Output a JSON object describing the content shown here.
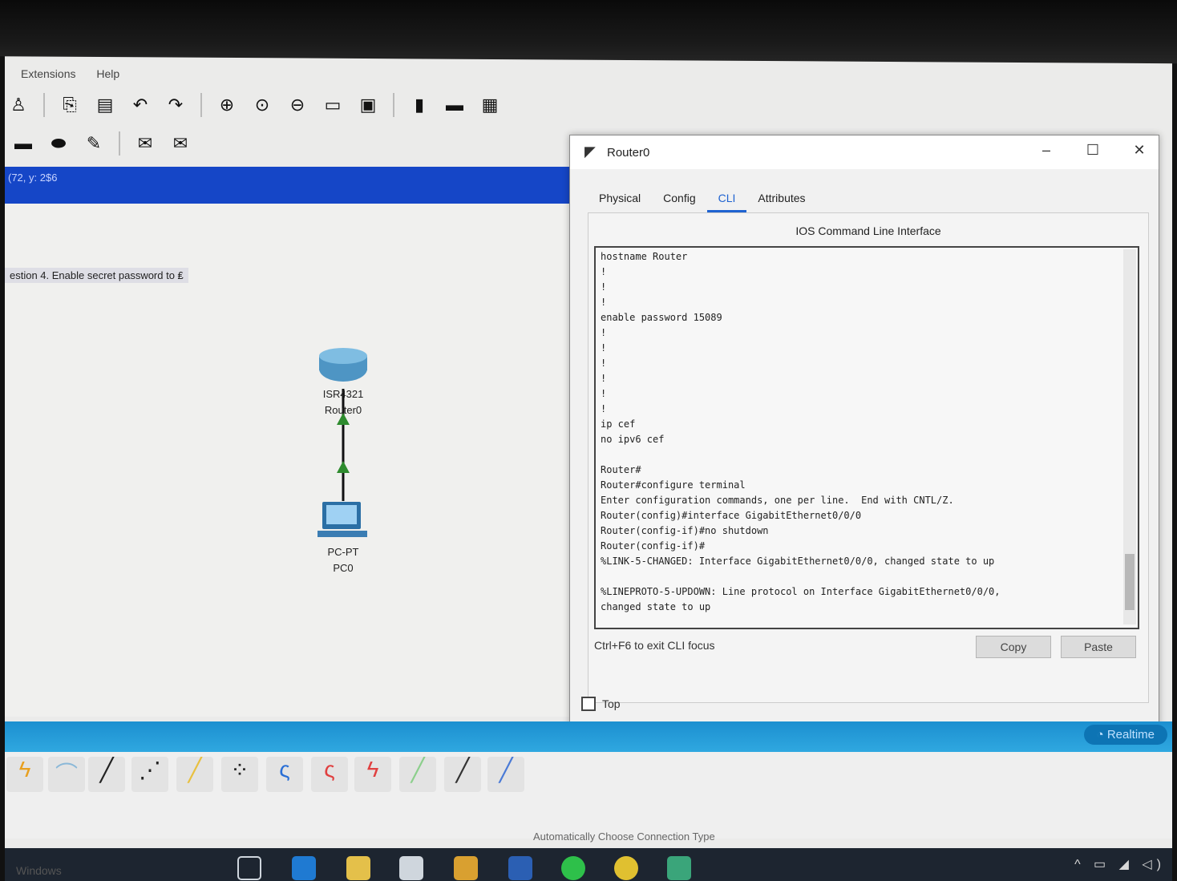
{
  "menu": {
    "extensions": "Extensions",
    "help": "Help"
  },
  "toolbar": {
    "row1": [
      "activity-wizard-icon",
      "copy-icon",
      "paste-icon",
      "undo-icon",
      "redo-icon",
      "zoom-in-icon",
      "zoom-reset-icon",
      "zoom-out-icon",
      "rectangle-icon",
      "palette-icon",
      "device-icon",
      "folder-icon",
      "image-icon"
    ],
    "row2": [
      "rect-draw-icon",
      "ellipse-draw-icon",
      "freeform-draw-icon",
      "mail-icon",
      "open-mail-icon"
    ]
  },
  "status": {
    "coords": "(72, y: 2$6"
  },
  "canvas": {
    "note": "estion 4. Enable secret password to ₤",
    "router": {
      "model": "ISR4321",
      "name": "Router0"
    },
    "pc": {
      "model": "PC-PT",
      "name": "PC0"
    }
  },
  "window": {
    "title": "Router0",
    "tabs": [
      "Physical",
      "Config",
      "CLI",
      "Attributes"
    ],
    "active_tab": "CLI",
    "heading": "IOS Command Line Interface",
    "console": "hostname Router\n!\n!\n!\nenable password 15089\n!\n!\n!\n!\n!\n!\nip cef\nno ipv6 cef\n\nRouter#\nRouter#configure terminal\nEnter configuration commands, one per line.  End with CNTL/Z.\nRouter(config)#interface GigabitEthernet0/0/0\nRouter(config-if)#no shutdown\nRouter(config-if)#\n%LINK-5-CHANGED: Interface GigabitEthernet0/0/0, changed state to up\n\n%LINEPROTO-5-UPDOWN: Line protocol on Interface GigabitEthernet0/0/0,\nchanged state to up",
    "hint": "Ctrl+F6 to exit CLI focus",
    "copy": "Copy",
    "paste": "Paste",
    "top_checkbox": "Top"
  },
  "bottom": {
    "realtime": "Realtime",
    "conn_type": "Automatically Choose Connection Type",
    "windows": "Windows"
  },
  "colors": {
    "accent": "#1546c7",
    "cyan": "#2fa8e0",
    "cli_tab": "#1f63d1"
  }
}
